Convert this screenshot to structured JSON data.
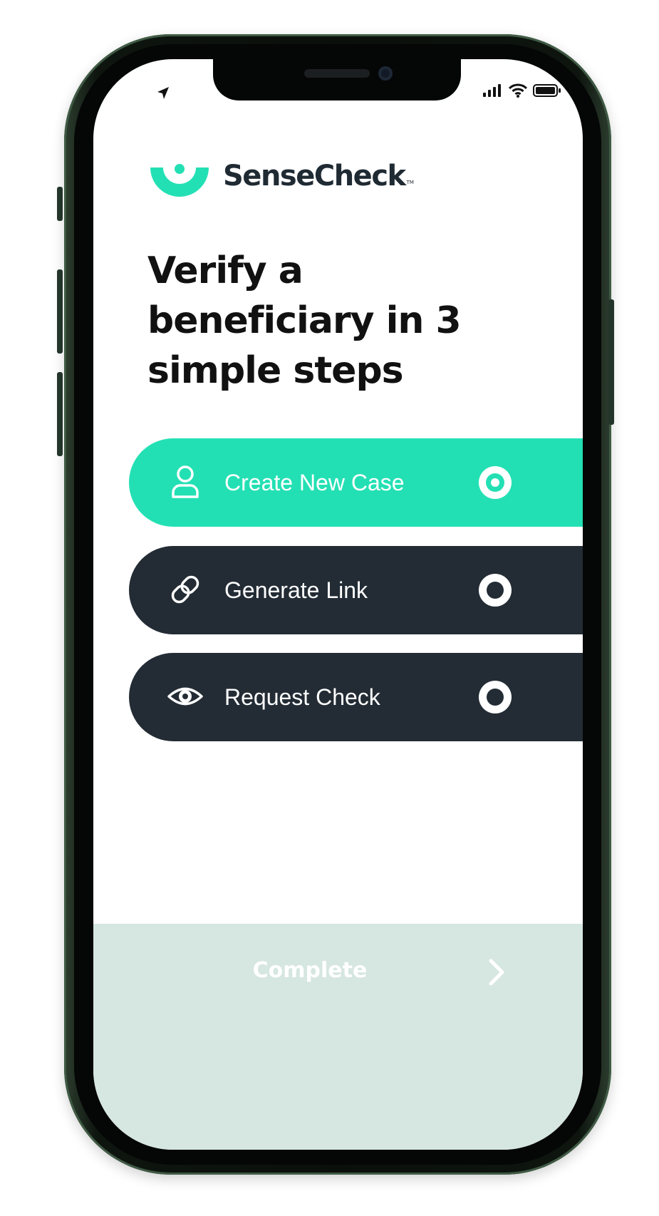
{
  "status_bar": {
    "left_icon": "location-arrow-icon",
    "right_icons": [
      "cellular-signal-icon",
      "wifi-icon",
      "battery-icon"
    ]
  },
  "brand": {
    "name": "SenseCheck",
    "tm": "TM",
    "logo_icon": "sensecheck-logo-icon"
  },
  "headline": "Verify a beneficiary in 3 simple steps",
  "steps": [
    {
      "label": "Create New Case",
      "icon": "user-icon",
      "state": "active",
      "radio": "selected"
    },
    {
      "label": "Generate Link",
      "icon": "link-icon",
      "state": "inactive",
      "radio": "unselected"
    },
    {
      "label": "Request Check",
      "icon": "eye-icon",
      "state": "inactive",
      "radio": "unselected"
    }
  ],
  "footer": {
    "complete_label": "Complete",
    "chevron_icon": "chevron-right-icon"
  },
  "colors": {
    "accent": "#23e0b4",
    "dark": "#232c35",
    "complete_bg": "#d6e6e1",
    "phone_frame": "#1a2a1d"
  }
}
